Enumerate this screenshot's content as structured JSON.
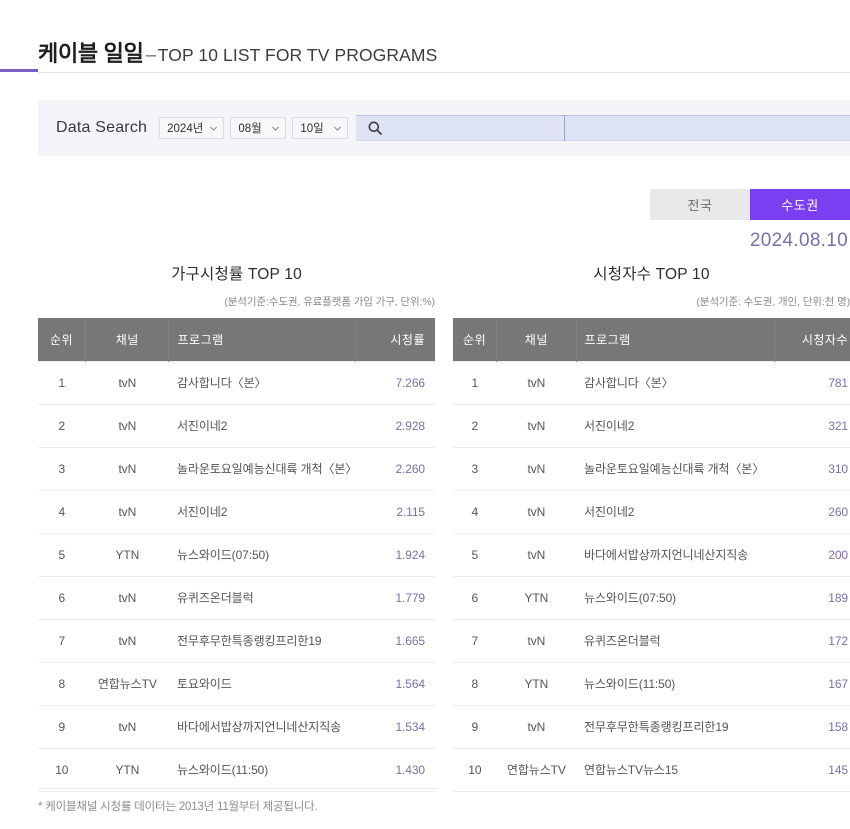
{
  "header": {
    "title_main": "케이블 일일",
    "title_dash": "–",
    "title_sub": "TOP 10 LIST FOR TV PROGRAMS"
  },
  "search": {
    "label": "Data Search",
    "year": "2024년",
    "month": "08월",
    "day": "10일",
    "keyword_value": "",
    "keyword_placeholder": "",
    "secondary_value": "",
    "search_icon": "search-icon",
    "chevron_icon": "chevron-down-icon"
  },
  "tabs": {
    "nationwide": "전국",
    "metro": "수도권",
    "active": "수도권"
  },
  "date_label": "2024.08.10",
  "tables": [
    {
      "key": "household_rating",
      "title": "가구시청률 TOP 10",
      "subtitle": "(분석기준:수도권, 유료플랫폼 가입 가구, 단위:%)",
      "columns": [
        "순위",
        "채널",
        "프로그램",
        "시청률"
      ],
      "rows": [
        {
          "rank": "1",
          "channel": "tvN",
          "program": "감사합니다〈본〉",
          "value": "7.266"
        },
        {
          "rank": "2",
          "channel": "tvN",
          "program": "서진이네2",
          "value": "2.928"
        },
        {
          "rank": "3",
          "channel": "tvN",
          "program": "놀라운토요일예능신대륙 개척〈본〉",
          "value": "2.260"
        },
        {
          "rank": "4",
          "channel": "tvN",
          "program": "서진이네2",
          "value": "2.115"
        },
        {
          "rank": "5",
          "channel": "YTN",
          "program": "뉴스와이드(07:50)",
          "value": "1.924"
        },
        {
          "rank": "6",
          "channel": "tvN",
          "program": "유퀴즈온더블럭",
          "value": "1.779"
        },
        {
          "rank": "7",
          "channel": "tvN",
          "program": "전무후무한특종랭킹프리한19",
          "value": "1.665"
        },
        {
          "rank": "8",
          "channel": "연합뉴스TV",
          "program": "토요와이드",
          "value": "1.564"
        },
        {
          "rank": "9",
          "channel": "tvN",
          "program": "바다에서밥상까지언니네산지직송",
          "value": "1.534"
        },
        {
          "rank": "10",
          "channel": "YTN",
          "program": "뉴스와이드(11:50)",
          "value": "1.430"
        }
      ]
    },
    {
      "key": "viewers",
      "title": "시청자수 TOP 10",
      "subtitle": "(분석기준: 수도권, 개인, 단위:천 명)",
      "columns": [
        "순위",
        "채널",
        "프로그램",
        "시청자수"
      ],
      "rows": [
        {
          "rank": "1",
          "channel": "tvN",
          "program": "감사합니다〈본〉",
          "value": "781"
        },
        {
          "rank": "2",
          "channel": "tvN",
          "program": "서진이네2",
          "value": "321"
        },
        {
          "rank": "3",
          "channel": "tvN",
          "program": "놀라운토요일예능신대륙 개척〈본〉",
          "value": "310"
        },
        {
          "rank": "4",
          "channel": "tvN",
          "program": "서진이네2",
          "value": "260"
        },
        {
          "rank": "5",
          "channel": "tvN",
          "program": "바다에서밥상까지언니네산지직송",
          "value": "200"
        },
        {
          "rank": "6",
          "channel": "YTN",
          "program": "뉴스와이드(07:50)",
          "value": "189"
        },
        {
          "rank": "7",
          "channel": "tvN",
          "program": "유퀴즈온더블럭",
          "value": "172"
        },
        {
          "rank": "8",
          "channel": "YTN",
          "program": "뉴스와이드(11:50)",
          "value": "167"
        },
        {
          "rank": "9",
          "channel": "tvN",
          "program": "전무후무한특종랭킹프리한19",
          "value": "158"
        },
        {
          "rank": "10",
          "channel": "연합뉴스TV",
          "program": "연합뉴스TV뉴스15",
          "value": "145"
        }
      ]
    }
  ],
  "footnote": "* 케이블채널 시청률 데이터는 2013년 11월부터 제공됩니다.",
  "colors": {
    "accent_purple": "#7b5fc4",
    "tab_active": "#7a3ff0",
    "value_purple": "#7b6fa8",
    "table_header_gray": "#77777a",
    "search_panel_bg": "#f4f5f8",
    "search_field_bg": "#dfe4f5"
  }
}
